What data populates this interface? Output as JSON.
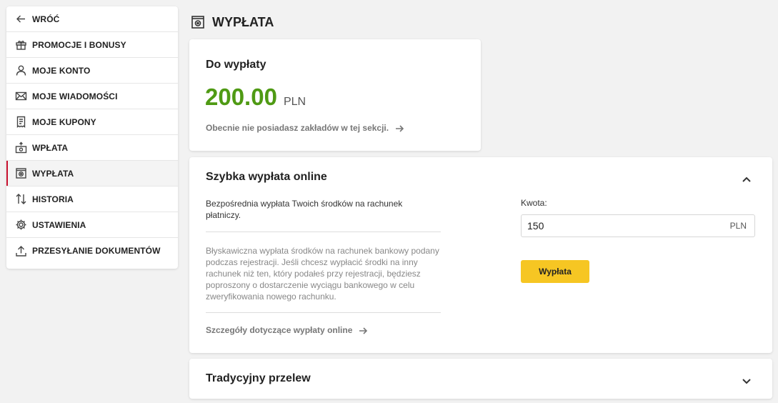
{
  "sidebar": {
    "items": [
      {
        "label": "WRÓĆ",
        "icon": "arrow-left-icon"
      },
      {
        "label": "PROMOCJE I BONUSY",
        "icon": "gift-icon"
      },
      {
        "label": "MOJE KONTO",
        "icon": "user-icon"
      },
      {
        "label": "MOJE WIADOMOŚCI",
        "icon": "envelope-icon"
      },
      {
        "label": "MOJE KUPONY",
        "icon": "receipt-icon"
      },
      {
        "label": "WPŁATA",
        "icon": "deposit-icon"
      },
      {
        "label": "WYPŁATA",
        "icon": "withdraw-icon",
        "active": true
      },
      {
        "label": "HISTORIA",
        "icon": "arrows-up-down-icon"
      },
      {
        "label": "USTAWIENIA",
        "icon": "gear-icon"
      },
      {
        "label": "PRZESYŁANIE DOKUMENTÓW",
        "icon": "upload-icon"
      }
    ]
  },
  "header": {
    "title": "WYPŁATA",
    "icon": "withdraw-icon"
  },
  "balance": {
    "label": "Do wypłaty",
    "amount": "200.00",
    "currency": "PLN",
    "info_link": "Obecnie nie posiadasz zakładów w tej sekcji."
  },
  "fast": {
    "title": "Szybka wypłata online",
    "desc1": "Bezpośrednia wypłata Twoich środków na rachunek płatniczy.",
    "desc2": "Błyskawiczna wypłata środków na rachunek bankowy podany podczas rejestracji. Jeśli chcesz wypłacić środki na inny rachunek niż ten, który podałeś przy rejestracji, będziesz poproszony o dostarczenie wyciągu bankowego w celu zweryfikowania nowego rachunku.",
    "details_link": "Szczegóły dotyczące wypłaty online",
    "amount_label": "Kwota:",
    "amount_value": "150",
    "amount_currency": "PLN",
    "button": "Wypłata"
  },
  "traditional": {
    "title": "Tradycyjny przelew"
  },
  "colors": {
    "accent_green": "#4f9a14",
    "button_yellow": "#f6c623",
    "active_red": "#c8102e"
  }
}
